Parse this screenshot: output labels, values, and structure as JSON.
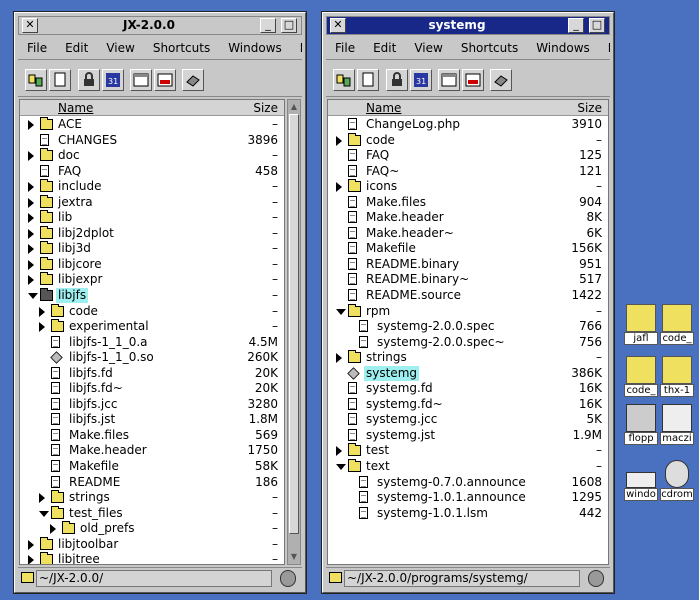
{
  "windows": [
    {
      "title": "JX-2.0.0",
      "menu": [
        "File",
        "Edit",
        "View",
        "Shortcuts",
        "Windows",
        "Prefe"
      ],
      "columns": {
        "name": "Name",
        "size": "Size"
      },
      "status_path": "~/JX-2.0.0/",
      "rows": [
        {
          "indent": 0,
          "tw": "closed",
          "icon": "folder",
          "name": "ACE",
          "size": "–"
        },
        {
          "indent": 0,
          "tw": "",
          "icon": "file",
          "name": "CHANGES",
          "size": "3896"
        },
        {
          "indent": 0,
          "tw": "closed",
          "icon": "folder",
          "name": "doc",
          "size": "–"
        },
        {
          "indent": 0,
          "tw": "",
          "icon": "file",
          "name": "FAQ",
          "size": "458"
        },
        {
          "indent": 0,
          "tw": "closed",
          "icon": "folder",
          "name": "include",
          "size": "–"
        },
        {
          "indent": 0,
          "tw": "closed",
          "icon": "folder",
          "name": "jextra",
          "size": "–"
        },
        {
          "indent": 0,
          "tw": "closed",
          "icon": "folder",
          "name": "lib",
          "size": "–"
        },
        {
          "indent": 0,
          "tw": "closed",
          "icon": "folder",
          "name": "libj2dplot",
          "size": "–"
        },
        {
          "indent": 0,
          "tw": "closed",
          "icon": "folder",
          "name": "libj3d",
          "size": "–"
        },
        {
          "indent": 0,
          "tw": "closed",
          "icon": "folder",
          "name": "libjcore",
          "size": "–"
        },
        {
          "indent": 0,
          "tw": "closed",
          "icon": "folder",
          "name": "libjexpr",
          "size": "–"
        },
        {
          "indent": 0,
          "tw": "open",
          "icon": "folder-dark",
          "name": "libjfs",
          "size": "–",
          "selected": true
        },
        {
          "indent": 1,
          "tw": "closed",
          "icon": "folder",
          "name": "code",
          "size": "–"
        },
        {
          "indent": 1,
          "tw": "closed",
          "icon": "folder",
          "name": "experimental",
          "size": "–"
        },
        {
          "indent": 1,
          "tw": "",
          "icon": "file",
          "name": "libjfs-1_1_0.a",
          "size": "4.5M"
        },
        {
          "indent": 1,
          "tw": "",
          "icon": "exec",
          "name": "libjfs-1_1_0.so",
          "size": "260K"
        },
        {
          "indent": 1,
          "tw": "",
          "icon": "file",
          "name": "libjfs.fd",
          "size": "20K"
        },
        {
          "indent": 1,
          "tw": "",
          "icon": "file",
          "name": "libjfs.fd~",
          "size": "20K"
        },
        {
          "indent": 1,
          "tw": "",
          "icon": "file",
          "name": "libjfs.jcc",
          "size": "3280"
        },
        {
          "indent": 1,
          "tw": "",
          "icon": "file",
          "name": "libjfs.jst",
          "size": "1.8M"
        },
        {
          "indent": 1,
          "tw": "",
          "icon": "file",
          "name": "Make.files",
          "size": "569"
        },
        {
          "indent": 1,
          "tw": "",
          "icon": "file",
          "name": "Make.header",
          "size": "1750"
        },
        {
          "indent": 1,
          "tw": "",
          "icon": "file",
          "name": "Makefile",
          "size": "58K"
        },
        {
          "indent": 1,
          "tw": "",
          "icon": "file",
          "name": "README",
          "size": "186"
        },
        {
          "indent": 1,
          "tw": "closed",
          "icon": "folder",
          "name": "strings",
          "size": "–"
        },
        {
          "indent": 1,
          "tw": "open",
          "icon": "folder",
          "name": "test_files",
          "size": "–"
        },
        {
          "indent": 2,
          "tw": "closed",
          "icon": "folder",
          "name": "old_prefs",
          "size": "–"
        },
        {
          "indent": 0,
          "tw": "closed",
          "icon": "folder",
          "name": "libjtoolbar",
          "size": "–"
        },
        {
          "indent": 0,
          "tw": "closed",
          "icon": "folder",
          "name": "libjtree",
          "size": "–"
        }
      ]
    },
    {
      "title": "systemg",
      "menu": [
        "File",
        "Edit",
        "View",
        "Shortcuts",
        "Windows",
        "Prefe"
      ],
      "columns": {
        "name": "Name",
        "size": "Size"
      },
      "status_path": "~/JX-2.0.0/programs/systemg/",
      "rows": [
        {
          "indent": 0,
          "tw": "",
          "icon": "file",
          "name": "ChangeLog.php",
          "size": "3910"
        },
        {
          "indent": 0,
          "tw": "closed",
          "icon": "folder",
          "name": "code",
          "size": "–"
        },
        {
          "indent": 0,
          "tw": "",
          "icon": "file",
          "name": "FAQ",
          "size": "125"
        },
        {
          "indent": 0,
          "tw": "",
          "icon": "file",
          "name": "FAQ~",
          "size": "121"
        },
        {
          "indent": 0,
          "tw": "closed",
          "icon": "folder",
          "name": "icons",
          "size": "–"
        },
        {
          "indent": 0,
          "tw": "",
          "icon": "file",
          "name": "Make.files",
          "size": "904"
        },
        {
          "indent": 0,
          "tw": "",
          "icon": "file",
          "name": "Make.header",
          "size": "8K"
        },
        {
          "indent": 0,
          "tw": "",
          "icon": "file",
          "name": "Make.header~",
          "size": "6K"
        },
        {
          "indent": 0,
          "tw": "",
          "icon": "file",
          "name": "Makefile",
          "size": "156K"
        },
        {
          "indent": 0,
          "tw": "",
          "icon": "file",
          "name": "README.binary",
          "size": "951"
        },
        {
          "indent": 0,
          "tw": "",
          "icon": "file",
          "name": "README.binary~",
          "size": "517"
        },
        {
          "indent": 0,
          "tw": "",
          "icon": "file",
          "name": "README.source",
          "size": "1422"
        },
        {
          "indent": 0,
          "tw": "open",
          "icon": "folder",
          "name": "rpm",
          "size": "–"
        },
        {
          "indent": 1,
          "tw": "",
          "icon": "file",
          "name": "systemg-2.0.0.spec",
          "size": "766"
        },
        {
          "indent": 1,
          "tw": "",
          "icon": "file",
          "name": "systemg-2.0.0.spec~",
          "size": "756"
        },
        {
          "indent": 0,
          "tw": "closed",
          "icon": "folder",
          "name": "strings",
          "size": "–"
        },
        {
          "indent": 0,
          "tw": "",
          "icon": "exec",
          "name": "systemg",
          "size": "386K",
          "selected": true
        },
        {
          "indent": 0,
          "tw": "",
          "icon": "file",
          "name": "systemg.fd",
          "size": "16K"
        },
        {
          "indent": 0,
          "tw": "",
          "icon": "file",
          "name": "systemg.fd~",
          "size": "16K"
        },
        {
          "indent": 0,
          "tw": "",
          "icon": "file",
          "name": "systemg.jcc",
          "size": "5K"
        },
        {
          "indent": 0,
          "tw": "",
          "icon": "file",
          "name": "systemg.jst",
          "size": "1.9M"
        },
        {
          "indent": 0,
          "tw": "closed",
          "icon": "folder",
          "name": "test",
          "size": "–"
        },
        {
          "indent": 0,
          "tw": "open",
          "icon": "folder",
          "name": "text",
          "size": "–"
        },
        {
          "indent": 1,
          "tw": "",
          "icon": "file",
          "name": "systemg-0.7.0.announce",
          "size": "1608"
        },
        {
          "indent": 1,
          "tw": "",
          "icon": "file",
          "name": "systemg-1.0.1.announce",
          "size": "1295"
        },
        {
          "indent": 1,
          "tw": "",
          "icon": "file",
          "name": "systemg-1.0.1.lsm",
          "size": "442"
        }
      ]
    }
  ],
  "desktop_icons": [
    {
      "label": "jafl",
      "icon": "folder-home-icon"
    },
    {
      "label": "code_",
      "icon": "folder-icon"
    },
    {
      "label": "code_",
      "icon": "folder-icon"
    },
    {
      "label": "thx-1",
      "icon": "folder-icon"
    },
    {
      "label": "flopp",
      "icon": "floppy-icon"
    },
    {
      "label": "maczi",
      "icon": "zip-drive-icon"
    },
    {
      "label": "windo",
      "icon": "windows-partition-icon"
    },
    {
      "label": "cdrom",
      "icon": "cdrom-icon"
    }
  ],
  "colors": {
    "desktop": "#4a70c0",
    "active_title": "#182888",
    "selection": "#9ef0f0",
    "folder": "#f0e060"
  }
}
